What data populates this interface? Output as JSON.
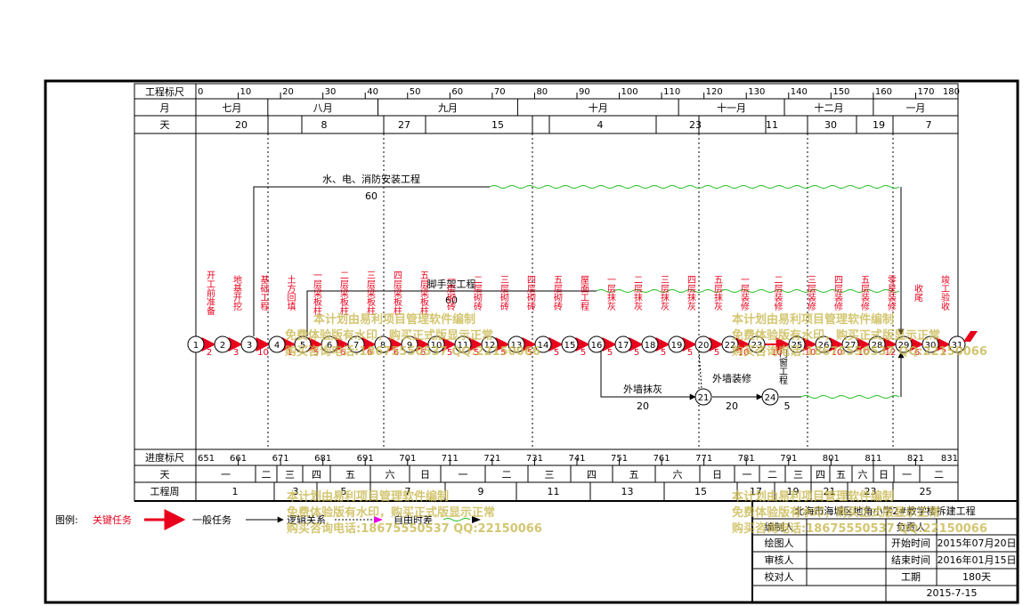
{
  "header": {
    "scale_label": "工程标尺",
    "scale_ticks": [
      "0",
      "10",
      "20",
      "30",
      "40",
      "50",
      "60",
      "70",
      "80",
      "90",
      "100",
      "110",
      "120",
      "130",
      "140",
      "150",
      "160",
      "170",
      "180"
    ],
    "month_label": "月",
    "months": [
      "七月",
      "八月",
      "九月",
      "十月",
      "十一月",
      "十二月",
      "一月"
    ],
    "day_label": "天",
    "month_days": [
      "20",
      "8",
      "27",
      "15",
      "4",
      "23",
      "11",
      "30",
      "19",
      "7"
    ]
  },
  "footer": {
    "progress_label": "进度标尺",
    "progress_ticks": [
      "651",
      "661",
      "671",
      "681",
      "691",
      "701",
      "711",
      "721",
      "731",
      "741",
      "751",
      "761",
      "771",
      "781",
      "791",
      "801",
      "811",
      "821",
      "831"
    ],
    "weekday_label": "天",
    "weekdays": [
      "一",
      "二",
      "三",
      "四",
      "五",
      "六",
      "日",
      "一",
      "二",
      "三",
      "四",
      "五",
      "六",
      "日",
      "一",
      "二",
      "三",
      "四",
      "五",
      "六",
      "日",
      "一",
      "二"
    ],
    "week_label": "工程周",
    "weeks": [
      "1",
      "3",
      "5",
      "7",
      "9",
      "11",
      "13",
      "15",
      "17",
      "19",
      "21",
      "23",
      "25"
    ]
  },
  "legend": {
    "title": "图例:",
    "critical": "关键任务",
    "general": "一般任务",
    "logic": "逻辑关系",
    "free_float": "自由时差"
  },
  "info": {
    "project_title": "北海市海城区地角小学2#教学楼拆建工程",
    "editor_label": "编制人",
    "manager_label": "负责人",
    "drawer_label": "绘图人",
    "reviewer_label": "审核人",
    "proofreader_label": "校对人",
    "start_label": "开始时间",
    "start_value": "2015年07月20日",
    "end_label": "结束时间",
    "end_value": "2016年01月15日",
    "duration_label": "工期",
    "duration_value": "180天",
    "date": "2015-7-15"
  },
  "watermark": {
    "line1": "本计划由易利项目管理软件编制",
    "line2": "免费体验版有水印，购买正式版显示正常",
    "line3": "购买咨询电话:18675550537 QQ:22150066"
  },
  "network": {
    "nodes": [
      "1",
      "2",
      "3",
      "4",
      "5",
      "6",
      "7",
      "8",
      "9",
      "10",
      "11",
      "12",
      "13",
      "14",
      "15",
      "16",
      "17",
      "18",
      "19",
      "20",
      "21",
      "22",
      "23",
      "24",
      "25",
      "26",
      "27",
      "28",
      "29",
      "30",
      "31"
    ],
    "tasks": [
      {
        "name": "开工前准备",
        "duration": "2"
      },
      {
        "name": "地基开挖",
        "duration": "3"
      },
      {
        "name": "基础工程",
        "duration": "10"
      },
      {
        "name": "土方回填",
        "duration": "1"
      },
      {
        "name": "一层梁板柱",
        "duration": "5"
      },
      {
        "name": "二层梁板柱",
        "duration": "6"
      },
      {
        "name": "三层梁板柱",
        "duration": "6"
      },
      {
        "name": "四层梁板柱",
        "duration": "6"
      },
      {
        "name": "五层梁板柱",
        "duration": "6"
      },
      {
        "name": "一层砌砖",
        "duration": "5"
      },
      {
        "name": "二层砌砖",
        "duration": "5"
      },
      {
        "name": "三层砌砖",
        "duration": "5"
      },
      {
        "name": "四层砌砖",
        "duration": "5"
      },
      {
        "name": "五层砌砖",
        "duration": "5"
      },
      {
        "name": "屋面工程",
        "duration": "5"
      },
      {
        "name": "一层抹灰",
        "duration": "5"
      },
      {
        "name": "二层抹灰",
        "duration": "5"
      },
      {
        "name": "三层抹灰",
        "duration": "5"
      },
      {
        "name": "四层抹灰",
        "duration": "5"
      },
      {
        "name": "五层抹灰",
        "duration": "5"
      },
      {
        "name": "一层装修",
        "duration": "10"
      },
      {
        "name": "二层装修",
        "duration": "10"
      },
      {
        "name": "三层装修",
        "duration": "10"
      },
      {
        "name": "四层装修",
        "duration": "10"
      },
      {
        "name": "五层装修",
        "duration": "10"
      },
      {
        "name": "零星装修",
        "duration": "12"
      },
      {
        "name": "收尾",
        "duration": "6"
      },
      {
        "name": "竣工验收",
        "duration": "2"
      }
    ],
    "side_tasks": {
      "utilities": {
        "name": "水、电、消防安装工程",
        "duration": "60"
      },
      "scaffold": {
        "name": "脚手架工程",
        "duration": "60"
      },
      "ext_plaster": {
        "name": "外墙抹灰",
        "duration": "20"
      },
      "ext_decor": {
        "name": "外墙装修",
        "duration": "20"
      },
      "doors": {
        "name": "门窗工程",
        "duration": "5"
      }
    }
  },
  "colors": {
    "critical": "#e8001c",
    "general": "#000000",
    "float": "#1fbf1f",
    "watermark": "#c9b84e"
  }
}
